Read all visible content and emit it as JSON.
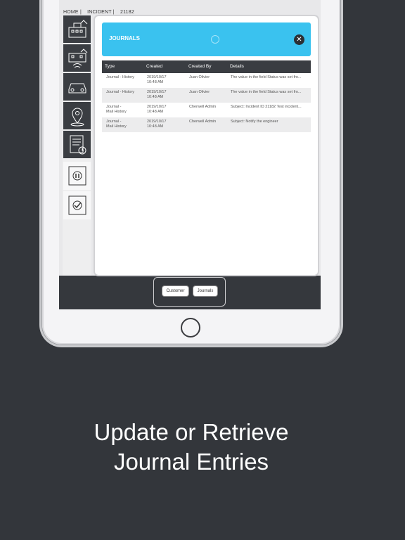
{
  "breadcrumb": [
    "HOME |",
    "INCIDENT |",
    "21182"
  ],
  "sidebar": {
    "items": [
      {
        "icon": "building-check-icon"
      },
      {
        "icon": "building-wifi-check-icon"
      },
      {
        "icon": "car-icon"
      },
      {
        "icon": "location-pin-icon"
      },
      {
        "icon": "document-clock-icon"
      },
      {
        "icon": "pause-icon"
      },
      {
        "icon": "checkmark-icon"
      }
    ]
  },
  "modal": {
    "title": "JOURNALS",
    "close_icon": "close-icon",
    "columns": [
      "Type",
      "Created",
      "Created By",
      "Details"
    ],
    "rows": [
      {
        "type": [
          "Journal - History"
        ],
        "created": [
          "2019/10/17",
          "10:48 AM"
        ],
        "created_by": "Juan Olivier",
        "details": "The value in the field Status was set fro..."
      },
      {
        "type": [
          "Journal - History"
        ],
        "created": [
          "2019/10/17",
          "10:48 AM"
        ],
        "created_by": "Juan Olivier",
        "details": "The value in the field Status was set fro..."
      },
      {
        "type": [
          "Journal -",
          "Mail History"
        ],
        "created": [
          "2019/10/17",
          "10:48 AM"
        ],
        "created_by": "Cherwell Admin",
        "details": "Subject: Incident ID 21182 Test incident..."
      },
      {
        "type": [
          "Journal -",
          "Mail History"
        ],
        "created": [
          "2019/10/17",
          "10:48 AM"
        ],
        "created_by": "Cherwell Admin",
        "details": "Subject: Notify the engineer"
      }
    ]
  },
  "bottom_tabs": {
    "customer": "Customer",
    "journals": "Journals"
  },
  "promo": {
    "line1": "Update or Retrieve",
    "line2": "Journal Entries"
  },
  "colors": {
    "accent": "#3ac2ef",
    "background": "#33363b",
    "dark_header": "#3a3d42"
  }
}
